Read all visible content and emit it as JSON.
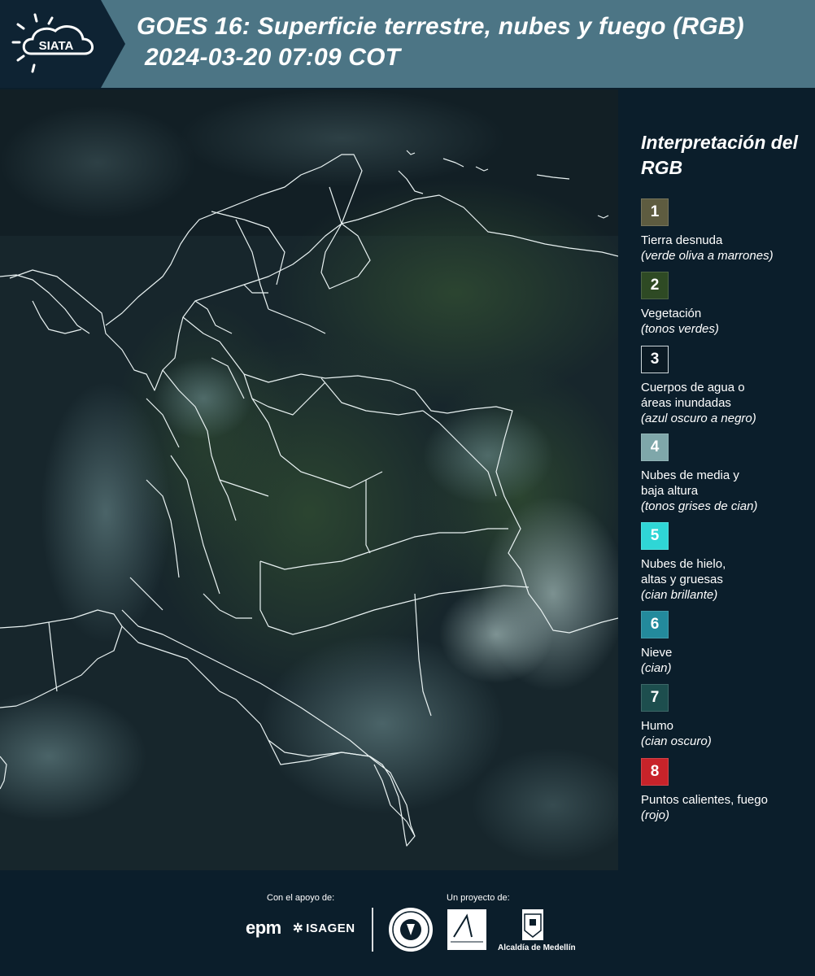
{
  "header": {
    "logo_text": "SIATA",
    "title_line1": "GOES 16: Superficie terrestre, nubes y fuego (RGB)",
    "title_line2": "2024-03-20 07:09 COT"
  },
  "legend": {
    "title": "Interpretación del RGB",
    "items": [
      {
        "number": "1",
        "label": "Tierra desnuda",
        "note": "(verde oliva a marrones)",
        "color": "#5e5c40"
      },
      {
        "number": "2",
        "label": "Vegetación",
        "note": "(tonos verdes)",
        "color": "#2e4a24"
      },
      {
        "number": "3",
        "label": "Cuerpos de agua o áreas inundadas",
        "note": "(azul oscuro a negro)",
        "color": "#0b1a24"
      },
      {
        "number": "4",
        "label": "Nubes de media y baja altura",
        "note": "(tonos grises de cian)",
        "color": "#7fa7aa"
      },
      {
        "number": "5",
        "label": "Nubes de hielo, altas y gruesas",
        "note": "(cian brillante)",
        "color": "#2fd6d6"
      },
      {
        "number": "6",
        "label": "Nieve",
        "note": "(cian)",
        "color": "#238a9c"
      },
      {
        "number": "7",
        "label": "Humo",
        "note": "(cian oscuro)",
        "color": "#1d4e4e"
      },
      {
        "number": "8",
        "label": "Puntos calientes, fuego",
        "note": "(rojo)",
        "color": "#c8232a"
      }
    ]
  },
  "footer": {
    "support_label": "Con el apoyo de:",
    "project_label": "Un proyecto de:",
    "sponsor_1": "epm",
    "sponsor_2": "ISAGEN",
    "partner_area": "Área Metropolitana",
    "partner_alcaldia": "Alcaldía de Medellín"
  }
}
